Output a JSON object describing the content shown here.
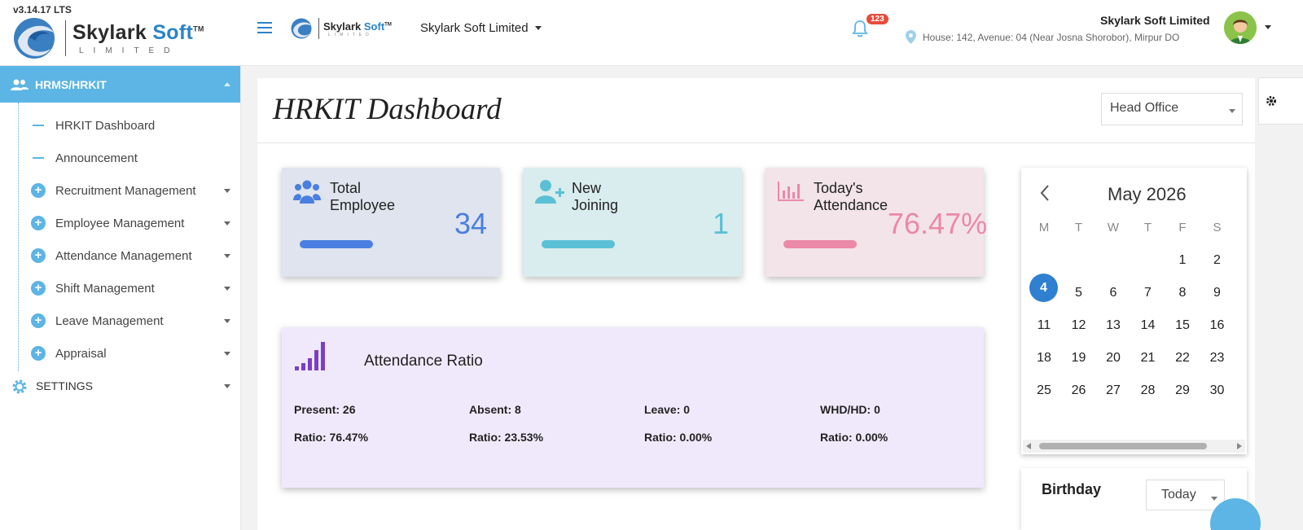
{
  "app": {
    "version": "v3.14.17 LTS",
    "logo": {
      "brand": "Skylark",
      "brand_accent": "Soft",
      "tm": "TM",
      "subtitle": "LIMITED"
    },
    "company": "Skylark Soft Limited",
    "notifications_count": "123",
    "address": "House: 142, Avenue: 04 (Near Josna Shorobor), Mirpur DO",
    "user_company": "Skylark Soft Limited"
  },
  "sidebar": {
    "module": "HRMS/HRKIT",
    "items": [
      {
        "label": "HRKIT Dashboard",
        "type": "leaf"
      },
      {
        "label": "Announcement",
        "type": "leaf"
      },
      {
        "label": "Recruitment Management",
        "type": "group"
      },
      {
        "label": "Employee Management",
        "type": "group"
      },
      {
        "label": "Attendance Management",
        "type": "group"
      },
      {
        "label": "Shift Management",
        "type": "group"
      },
      {
        "label": "Leave Management",
        "type": "group"
      },
      {
        "label": "Appraisal",
        "type": "group"
      }
    ],
    "settings": "SETTINGS"
  },
  "dashboard": {
    "title": "HRKIT Dashboard",
    "branch": "Head Office",
    "cards": [
      {
        "label_line1": "Total",
        "label_line2": "Employee",
        "value": "34",
        "color": "#4a7ee0",
        "bg": "#dfe4ee"
      },
      {
        "label_line1": "New",
        "label_line2": "Joining",
        "value": "1",
        "color": "#5bc0d6",
        "bg": "#d9ecee"
      },
      {
        "label_line1": "Today's",
        "label_line2": "Attendance",
        "value": "76.47%",
        "color": "#ec88a8",
        "bg": "#f2e4e9"
      }
    ],
    "attendance_ratio": {
      "title": "Attendance Ratio",
      "present": "Present: 26",
      "absent": "Absent: 8",
      "leave": "Leave: 0",
      "whd": "WHD/HD: 0",
      "present_ratio": "Ratio: 76.47%",
      "absent_ratio": "Ratio: 23.53%",
      "leave_ratio": "Ratio: 0.00%",
      "whd_ratio": "Ratio: 0.00%"
    }
  },
  "calendar": {
    "title": "May 2026",
    "weekdays": [
      "M",
      "T",
      "W",
      "T",
      "F",
      "S"
    ],
    "today": "4",
    "rows": [
      [
        "",
        "",
        "",
        "",
        "1",
        "2"
      ],
      [
        "4",
        "5",
        "6",
        "7",
        "8",
        "9"
      ],
      [
        "11",
        "12",
        "13",
        "14",
        "15",
        "16"
      ],
      [
        "18",
        "19",
        "20",
        "21",
        "22",
        "23"
      ],
      [
        "25",
        "26",
        "27",
        "28",
        "29",
        "30"
      ]
    ]
  },
  "birthday": {
    "title": "Birthday",
    "filter": "Today"
  }
}
